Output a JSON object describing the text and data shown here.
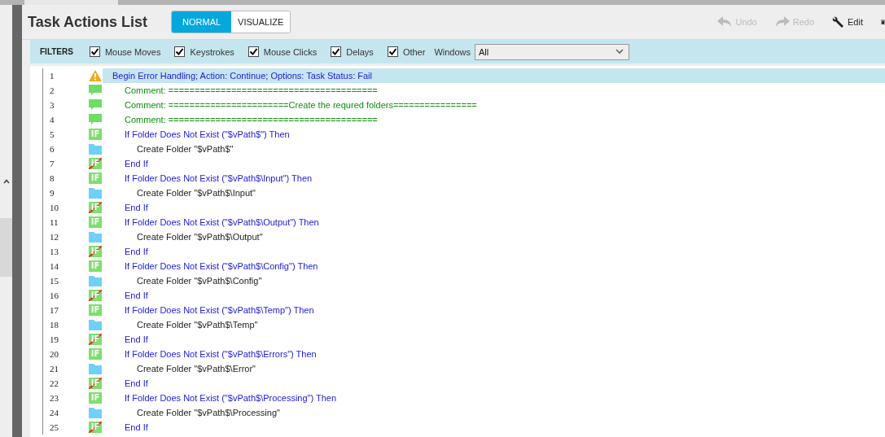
{
  "title": "Task Actions List",
  "view_modes": [
    {
      "label": "NORMAL",
      "selected": true
    },
    {
      "label": "VISUALIZE",
      "selected": false
    }
  ],
  "toolbar": [
    {
      "label": "Undo",
      "kind": "undo",
      "disabled": true
    },
    {
      "label": "Redo",
      "kind": "redo",
      "disabled": true
    },
    {
      "label": "Edit",
      "kind": "edit",
      "disabled": false
    },
    {
      "kind": "delete",
      "disabled": false
    }
  ],
  "filters": {
    "label": "FILTERS",
    "items": [
      {
        "label": "Mouse Moves",
        "checked": true
      },
      {
        "label": "Keystrokes",
        "checked": true
      },
      {
        "label": "Mouse Clicks",
        "checked": true
      },
      {
        "label": "Delays",
        "checked": true
      },
      {
        "label": "Other",
        "checked": true
      }
    ],
    "windows_label": "Windows",
    "windows_value": "All"
  },
  "actions": [
    {
      "line": "1",
      "kind": "error",
      "text": "Begin Error Handling; Action: Continue; Options:  Task Status: Fail",
      "selected": true,
      "children": [
        {
          "line": "2",
          "kind": "comment",
          "text": "Comment: ========================================",
          "selected": false
        },
        {
          "line": "3",
          "kind": "comment",
          "text": "Comment: =======================Create the requred folders================",
          "selected": false
        },
        {
          "line": "4",
          "kind": "comment",
          "text": "Comment: ========================================",
          "selected": false
        },
        {
          "line": "5",
          "kind": "if",
          "badge": "IF",
          "text": "If Folder Does Not Exist (\"$vPath$\")  Then",
          "selected": false,
          "children": [
            {
              "line": "6",
              "kind": "folder",
              "text": "Create Folder \"$vPath$\"",
              "selected": false
            }
          ]
        },
        {
          "line": "7",
          "kind": "endif",
          "badge": "IF",
          "text": "End If",
          "selected": false
        },
        {
          "line": "8",
          "kind": "if",
          "badge": "IF",
          "text": "If Folder Does Not Exist (\"$vPath$\\Input\")  Then",
          "selected": false,
          "children": [
            {
              "line": "9",
              "kind": "folder",
              "text": "Create Folder \"$vPath$\\Input\"",
              "selected": false
            }
          ]
        },
        {
          "line": "10",
          "kind": "endif",
          "badge": "IF",
          "text": "End If",
          "selected": false
        },
        {
          "line": "11",
          "kind": "if",
          "badge": "IF",
          "text": "If Folder Does Not Exist (\"$vPath$\\Output\")  Then",
          "selected": false,
          "children": [
            {
              "line": "12",
              "kind": "folder",
              "text": "Create Folder \"$vPath$\\Output\"",
              "selected": false
            }
          ]
        },
        {
          "line": "13",
          "kind": "endif",
          "badge": "IF",
          "text": "End If",
          "selected": false
        },
        {
          "line": "14",
          "kind": "if",
          "badge": "IF",
          "text": "If Folder Does Not Exist (\"$vPath$\\Config\")  Then",
          "selected": false,
          "children": [
            {
              "line": "15",
              "kind": "folder",
              "text": "Create Folder \"$vPath$\\Config\"",
              "selected": false
            }
          ]
        },
        {
          "line": "16",
          "kind": "endif",
          "badge": "IF",
          "text": "End If",
          "selected": false
        },
        {
          "line": "17",
          "kind": "if",
          "badge": "IF",
          "text": "If Folder Does Not Exist (\"$vPath$\\Temp\")  Then",
          "selected": false,
          "children": [
            {
              "line": "18",
              "kind": "folder",
              "text": "Create Folder \"$vPath$\\Temp\"",
              "selected": false
            }
          ]
        },
        {
          "line": "19",
          "kind": "endif",
          "badge": "IF",
          "text": "End If",
          "selected": false
        },
        {
          "line": "20",
          "kind": "if",
          "badge": "IF",
          "text": "If Folder Does Not Exist (\"$vPath$\\Errors\")  Then",
          "selected": false,
          "children": [
            {
              "line": "21",
              "kind": "folder",
              "text": "Create Folder \"$vPath$\\Error\"",
              "selected": false
            }
          ]
        },
        {
          "line": "22",
          "kind": "endif",
          "badge": "IF",
          "text": "End If",
          "selected": false
        },
        {
          "line": "23",
          "kind": "if",
          "badge": "IF",
          "text": "If Folder Does Not Exist (\"$vPath$\\Processing\")  Then",
          "selected": false,
          "children": [
            {
              "line": "24",
              "kind": "folder",
              "text": "Create Folder \"$vPath$\\Processing\"",
              "selected": false
            }
          ]
        },
        {
          "line": "25",
          "kind": "endif",
          "badge": "IF",
          "text": "End If",
          "selected": false
        }
      ]
    }
  ]
}
